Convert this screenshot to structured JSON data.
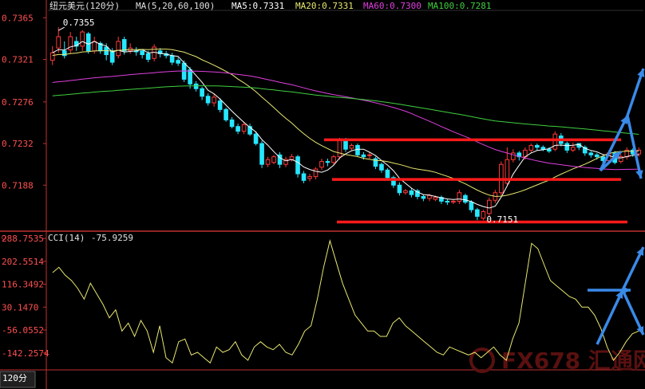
{
  "header": {
    "symbol": "纽元美元(120分)",
    "ma_params": "MA(5,20,60,100)",
    "ma5": "MA5:0.7331",
    "ma20": "MA20:0.7331",
    "ma60": "MA60:0.7300",
    "ma100": "MA100:0.7281"
  },
  "cci_header": {
    "label": "CCI(14)",
    "value": "-75.9259"
  },
  "period_tab": "120分",
  "watermark": "FX678 汇通网",
  "colors": {
    "up": "#ff3a3a",
    "down": "#27e6ff",
    "ma5": "#ffffff",
    "ma20": "#e8e870",
    "ma60": "#e040e0",
    "ma100": "#40d040",
    "cci": "#e8e870",
    "axis": "#c03030",
    "level": "#ff1a1a",
    "arrow": "#3a8ae8"
  },
  "chart_data": [
    {
      "type": "candlestick",
      "yticks": [
        "0.7365",
        "0.7321",
        "0.7276",
        "0.7232",
        "0.7188"
      ],
      "ylim": [
        0.7141,
        0.7372
      ],
      "annotations": [
        {
          "text": "0.7355",
          "value": 0.7355
        },
        {
          "text": "0.7151",
          "value": 0.7151
        }
      ],
      "levels": [
        0.7236,
        0.7194,
        0.7149
      ],
      "open": [
        0.732,
        0.7333,
        0.733,
        0.7331,
        0.734,
        0.7335,
        0.7348,
        0.733,
        0.7338,
        0.7334,
        0.733,
        0.7325,
        0.7342,
        0.733,
        0.733,
        0.733,
        0.7327,
        0.7322,
        0.733,
        0.7327,
        0.7325,
        0.732,
        0.7317,
        0.731,
        0.7295,
        0.729,
        0.7282,
        0.7275,
        0.7277,
        0.7268,
        0.7257,
        0.725,
        0.7245,
        0.725,
        0.7242,
        0.7232,
        0.721,
        0.7212,
        0.722,
        0.721,
        0.7215,
        0.7218,
        0.72,
        0.7195,
        0.7197,
        0.7207,
        0.7213,
        0.7212,
        0.7218,
        0.7236,
        0.7227,
        0.723,
        0.722,
        0.722,
        0.7216,
        0.721,
        0.7204,
        0.7196,
        0.7188,
        0.718,
        0.7182,
        0.7182,
        0.7176,
        0.7174,
        0.7173,
        0.7175,
        0.7171,
        0.717,
        0.7171,
        0.7177,
        0.717,
        0.7162,
        0.7153,
        0.7158,
        0.7172,
        0.718,
        0.719,
        0.7215,
        0.7222,
        0.7218,
        0.7225,
        0.723,
        0.7228,
        0.7226,
        0.7226,
        0.724,
        0.7232,
        0.7225,
        0.7232,
        0.7228,
        0.7222,
        0.722,
        0.7218,
        0.7214,
        0.7222,
        0.7213,
        0.7218,
        0.7225,
        0.7221
      ],
      "close": [
        0.7328,
        0.7345,
        0.7325,
        0.7345,
        0.7335,
        0.735,
        0.733,
        0.734,
        0.733,
        0.7326,
        0.7318,
        0.734,
        0.733,
        0.7333,
        0.7329,
        0.7326,
        0.7321,
        0.7334,
        0.7327,
        0.7325,
        0.7318,
        0.7317,
        0.73,
        0.7295,
        0.729,
        0.7282,
        0.7275,
        0.7281,
        0.7268,
        0.7257,
        0.725,
        0.7245,
        0.7252,
        0.7242,
        0.7232,
        0.721,
        0.7215,
        0.7218,
        0.721,
        0.7215,
        0.7218,
        0.72,
        0.7193,
        0.7197,
        0.7205,
        0.7213,
        0.7212,
        0.7218,
        0.7236,
        0.7226,
        0.723,
        0.722,
        0.7218,
        0.722,
        0.7208,
        0.7204,
        0.7196,
        0.7188,
        0.718,
        0.7182,
        0.7178,
        0.7176,
        0.7174,
        0.7177,
        0.7175,
        0.7171,
        0.717,
        0.7171,
        0.718,
        0.717,
        0.7162,
        0.7155,
        0.716,
        0.7172,
        0.718,
        0.721,
        0.7215,
        0.7222,
        0.7218,
        0.7225,
        0.723,
        0.7228,
        0.7226,
        0.7224,
        0.7242,
        0.7232,
        0.7225,
        0.7228,
        0.7228,
        0.7222,
        0.722,
        0.7218,
        0.7214,
        0.7222,
        0.7212,
        0.7218,
        0.7225,
        0.7221,
        0.7225
      ],
      "high": [
        0.7335,
        0.7355,
        0.734,
        0.735,
        0.7345,
        0.7352,
        0.735,
        0.7345,
        0.734,
        0.7338,
        0.7333,
        0.7345,
        0.7345,
        0.7338,
        0.7334,
        0.7332,
        0.733,
        0.7337,
        0.7333,
        0.733,
        0.7328,
        0.7323,
        0.732,
        0.7313,
        0.7298,
        0.7292,
        0.7285,
        0.7284,
        0.728,
        0.727,
        0.726,
        0.7253,
        0.7255,
        0.7253,
        0.7245,
        0.7235,
        0.7218,
        0.722,
        0.7223,
        0.7218,
        0.7221,
        0.722,
        0.7203,
        0.72,
        0.7207,
        0.7216,
        0.7216,
        0.722,
        0.7238,
        0.7238,
        0.7232,
        0.7232,
        0.7223,
        0.7223,
        0.7218,
        0.7212,
        0.7206,
        0.7198,
        0.7191,
        0.7184,
        0.7185,
        0.7184,
        0.7178,
        0.7179,
        0.7177,
        0.7177,
        0.7173,
        0.7173,
        0.7183,
        0.7179,
        0.7172,
        0.7164,
        0.7162,
        0.7175,
        0.7183,
        0.7213,
        0.7228,
        0.7226,
        0.7224,
        0.7228,
        0.7232,
        0.7232,
        0.723,
        0.7228,
        0.7245,
        0.7243,
        0.7234,
        0.7233,
        0.7232,
        0.723,
        0.7224,
        0.7222,
        0.7219,
        0.7225,
        0.7224,
        0.7221,
        0.7228,
        0.7227,
        0.7228
      ],
      "low": [
        0.7315,
        0.7328,
        0.7322,
        0.7327,
        0.733,
        0.733,
        0.7327,
        0.7327,
        0.7327,
        0.732,
        0.7315,
        0.7322,
        0.7326,
        0.7327,
        0.7325,
        0.7322,
        0.7318,
        0.7319,
        0.7323,
        0.7322,
        0.7315,
        0.7314,
        0.7297,
        0.729,
        0.7287,
        0.7278,
        0.7272,
        0.7271,
        0.7265,
        0.7255,
        0.7248,
        0.7242,
        0.7242,
        0.724,
        0.723,
        0.7206,
        0.7207,
        0.721,
        0.7206,
        0.7207,
        0.7213,
        0.7196,
        0.719,
        0.7192,
        0.7194,
        0.7204,
        0.7208,
        0.7209,
        0.7215,
        0.7223,
        0.7225,
        0.7218,
        0.7215,
        0.7216,
        0.7205,
        0.7201,
        0.7193,
        0.7185,
        0.7177,
        0.7178,
        0.7175,
        0.7173,
        0.7171,
        0.7171,
        0.7171,
        0.7168,
        0.7167,
        0.7168,
        0.7168,
        0.7168,
        0.7159,
        0.7151,
        0.7151,
        0.7155,
        0.7169,
        0.7177,
        0.7188,
        0.7212,
        0.7214,
        0.7215,
        0.7222,
        0.7225,
        0.7224,
        0.7222,
        0.7224,
        0.7229,
        0.7222,
        0.7223,
        0.7225,
        0.7219,
        0.7217,
        0.7215,
        0.721,
        0.721,
        0.721,
        0.7211,
        0.7215,
        0.7218,
        0.7218
      ]
    },
    {
      "type": "line",
      "name": "CCI(14)",
      "yticks": [
        "288.7535",
        "202.5514",
        "116.3492",
        "30.1470",
        "-56.0552",
        "-142.2574"
      ],
      "ylim": [
        -200,
        310
      ],
      "values": [
        160,
        180,
        150,
        130,
        100,
        60,
        120,
        80,
        40,
        -10,
        20,
        -60,
        -30,
        -80,
        -20,
        -60,
        -140,
        -40,
        -160,
        -180,
        -100,
        -90,
        -150,
        -140,
        -160,
        -180,
        -120,
        -140,
        -130,
        -100,
        -150,
        -170,
        -120,
        -100,
        -120,
        -130,
        -110,
        -140,
        -150,
        -110,
        -60,
        -40,
        60,
        180,
        280,
        200,
        120,
        60,
        0,
        -30,
        -60,
        -60,
        -80,
        -80,
        -30,
        -10,
        -40,
        -60,
        -80,
        -100,
        -120,
        -140,
        -150,
        -120,
        -130,
        -140,
        -150,
        -140,
        -160,
        -140,
        -120,
        -150,
        -170,
        -90,
        -30,
        120,
        270,
        250,
        190,
        130,
        110,
        90,
        70,
        60,
        30,
        30,
        0,
        -50,
        -120,
        -170,
        -140,
        -100,
        -70,
        -60
      ]
    }
  ]
}
